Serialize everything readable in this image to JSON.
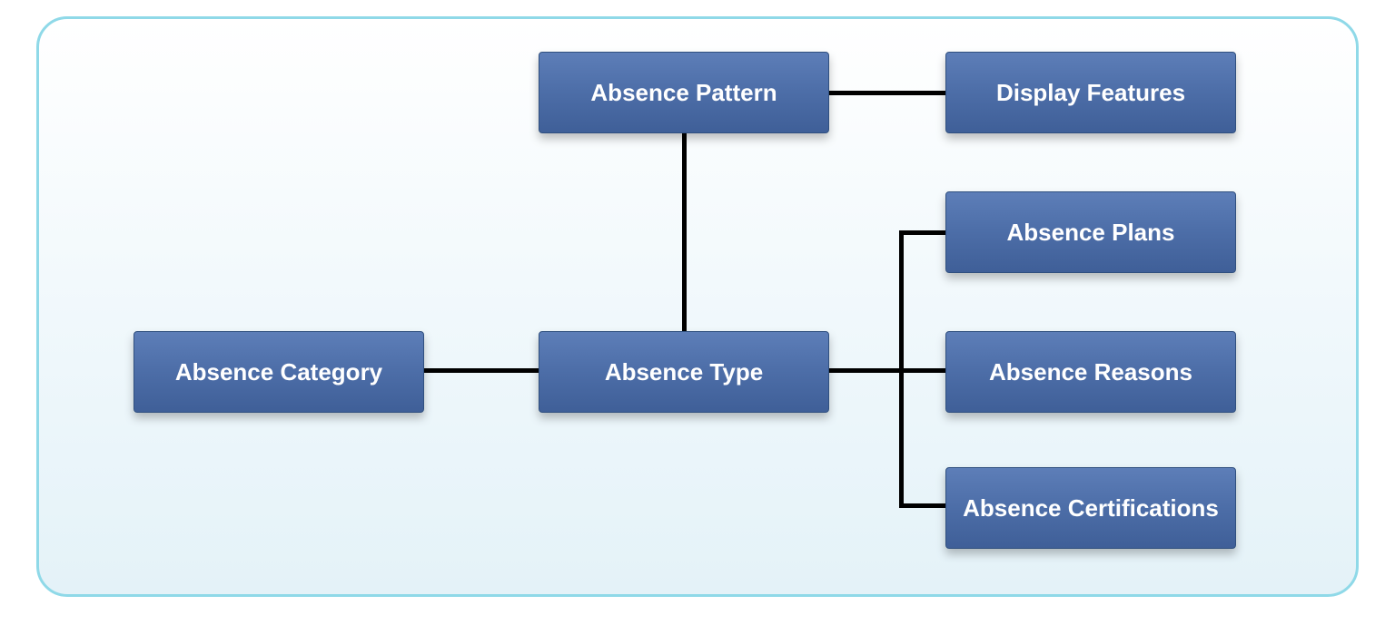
{
  "nodes": {
    "absence_category": "Absence Category",
    "absence_type": "Absence Type",
    "absence_pattern": "Absence Pattern",
    "display_features": "Display Features",
    "absence_plans": "Absence Plans",
    "absence_reasons": "Absence Reasons",
    "absence_certifications": "Absence Certifications"
  },
  "colors": {
    "node_fill": "#4d6ea8",
    "frame_border": "#8fd9e8",
    "connector": "#000000"
  }
}
